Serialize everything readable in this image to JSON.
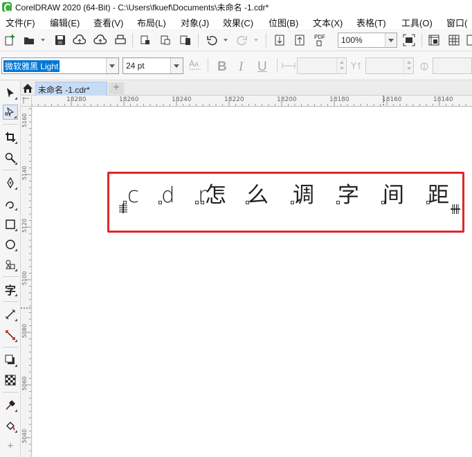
{
  "window": {
    "title": "CorelDRAW 2020 (64-Bit) - C:\\Users\\fkuef\\Documents\\未命名 -1.cdr*"
  },
  "menu": [
    "文件(F)",
    "编辑(E)",
    "查看(V)",
    "布局(L)",
    "对象(J)",
    "效果(C)",
    "位图(B)",
    "文本(X)",
    "表格(T)",
    "工具(O)",
    "窗口("
  ],
  "toolbar": {
    "zoom": "100%",
    "pdf_label": "PDF"
  },
  "property_bar": {
    "font_name": "微软雅黑 Light",
    "font_size": "24 pt",
    "bold": "B",
    "italic": "I",
    "underline": "U"
  },
  "document_tab": {
    "label": "未命名 -1.cdr*",
    "add": "+"
  },
  "rulers": {
    "horizontal": [
      "18280",
      "18260",
      "18240",
      "18220",
      "18200",
      "18180",
      "18160",
      "18140"
    ],
    "vertical": [
      "5160",
      "5140",
      "5120",
      "5100",
      "5080",
      "5060",
      "5040"
    ]
  },
  "canvas_text": {
    "glyphs": [
      "c",
      "d",
      "r",
      "怎",
      "么",
      "调",
      "字",
      "间",
      "距"
    ]
  },
  "colors": {
    "highlight": "#e0262b",
    "selection": "#0078d7",
    "tab_active": "#c7dbf4"
  }
}
